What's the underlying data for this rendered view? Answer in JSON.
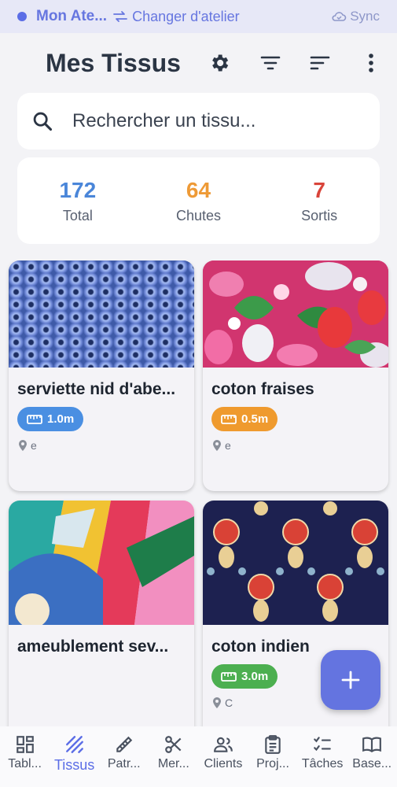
{
  "workshop": {
    "name": "Mon Ate...",
    "switch_label": "Changer d'atelier",
    "sync_label": "Sync"
  },
  "header": {
    "title": "Mes Tissus",
    "icons": [
      "gear-icon",
      "filter-icon",
      "sort-icon",
      "more-vert-icon"
    ]
  },
  "search": {
    "placeholder": "Rechercher un tissu..."
  },
  "stats": [
    {
      "value": "172",
      "label": "Total",
      "color": "#4a86d9"
    },
    {
      "value": "64",
      "label": "Chutes",
      "color": "#ee9a36"
    },
    {
      "value": "7",
      "label": "Sortis",
      "color": "#d9443a"
    }
  ],
  "fabrics": [
    {
      "title": "serviette nid d'abe...",
      "length": "1.0m",
      "chip_color": "#4a8fe2",
      "location": "e"
    },
    {
      "title": "coton fraises",
      "length": "0.5m",
      "chip_color": "#ef9a2e",
      "location": "e"
    },
    {
      "title": "ameublement sev...",
      "length": "",
      "chip_color": "#ef9a2e",
      "location": ""
    },
    {
      "title": "coton indien",
      "length": "3.0m",
      "chip_color": "#4caf50",
      "location": "C"
    }
  ],
  "fab": {
    "icon": "plus-icon"
  },
  "nav": [
    {
      "label": "Tabl...",
      "icon": "dashboard-icon",
      "active": false
    },
    {
      "label": "Tissus",
      "icon": "fabric-icon",
      "active": true
    },
    {
      "label": "Patr...",
      "icon": "pattern-icon",
      "active": false
    },
    {
      "label": "Mer...",
      "icon": "scissors-icon",
      "active": false
    },
    {
      "label": "Clients",
      "icon": "clients-icon",
      "active": false
    },
    {
      "label": "Proj...",
      "icon": "clipboard-icon",
      "active": false
    },
    {
      "label": "Tâches",
      "icon": "checklist-icon",
      "active": false
    },
    {
      "label": "Base...",
      "icon": "book-icon",
      "active": false
    }
  ]
}
